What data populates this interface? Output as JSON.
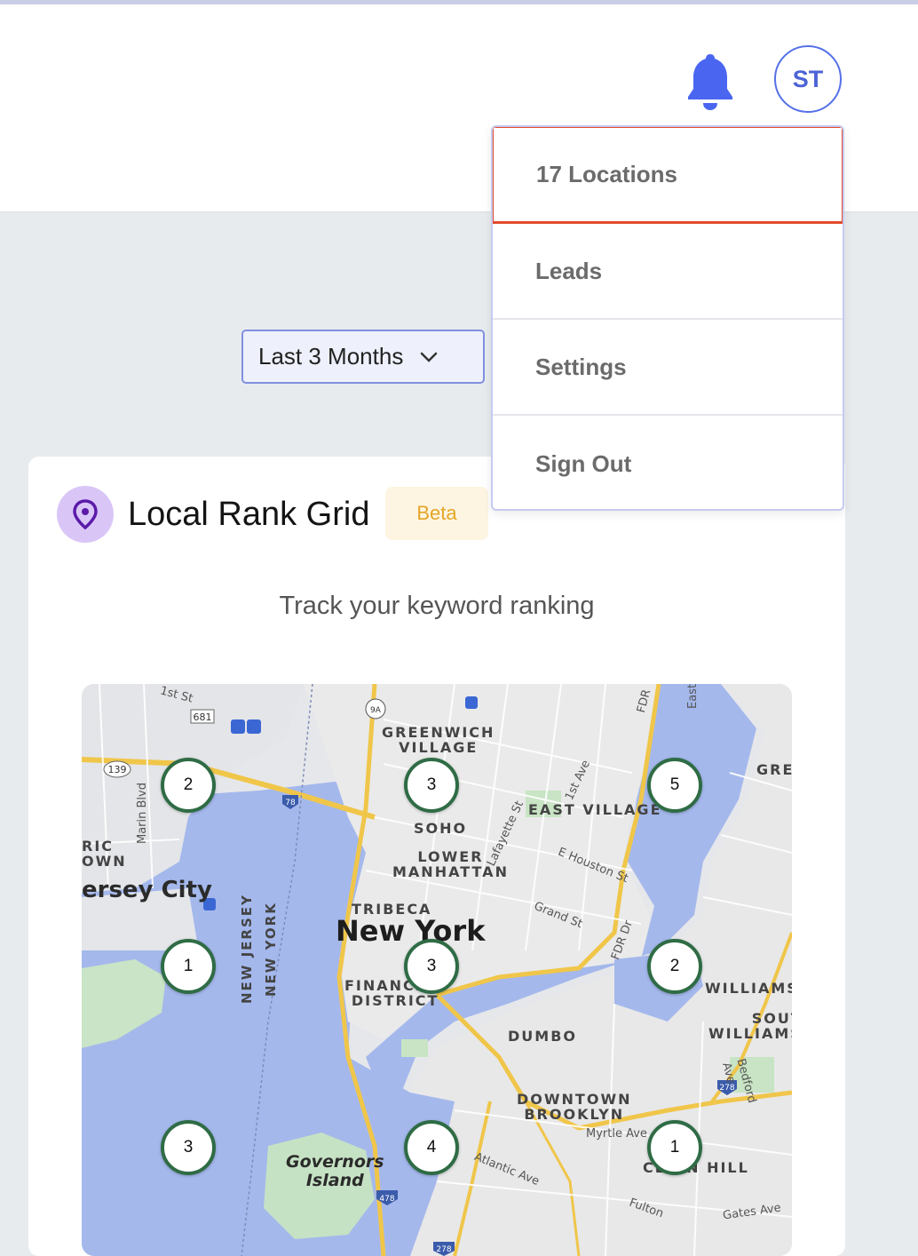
{
  "header": {
    "avatar_initials": "ST",
    "bell_icon": "bell-icon",
    "accent_color": "#4a66f0"
  },
  "menu": {
    "items": [
      "17 Locations",
      "Leads",
      "Settings",
      "Sign Out"
    ],
    "highlight_color": "#e24a2c"
  },
  "filter": {
    "date_range": "Last 3 Months",
    "chevron_icon": "chevron-down-icon"
  },
  "card": {
    "icon": "location-pin-icon",
    "title": "Local Rank Grid",
    "badge": "Beta",
    "subtitle": "Track your keyword ranking"
  },
  "map": {
    "ranks": [
      "2",
      "3",
      "5",
      "1",
      "3",
      "2",
      "3",
      "4",
      "1"
    ],
    "labels": {
      "greenwich": "GREENWICH\nVILLAGE",
      "east_village": "EAST VILLAGE",
      "soho": "SOHO",
      "lower_manhattan": "LOWER\nMANHATTAN",
      "tribeca": "TRIBECA",
      "new_york": "New York",
      "financial": "FINANCIAL\nDISTRICT",
      "dumbo": "DUMBO",
      "downtown_brooklyn": "DOWNTOWN\nBROOKLYN",
      "williamsburg": "WILLIAMSI",
      "south_williamsburg": "SOUT\nWILLIAMS",
      "jersey_city": "ersey City",
      "governors": "Governors\nIsland",
      "nj": "NEW JERSEY",
      "ny": "NEW YORK",
      "gree": "GREI",
      "historic": "RIC\nOWN",
      "clinton": "CL    ON HILL",
      "myrtle": "Myrtle Ave",
      "atlantic": "Atlantic Ave",
      "houston": "E Houston St",
      "grand": "Grand St",
      "lafayette": "Lafayette St",
      "first_ave": "1st Ave",
      "fdr": "FDR Dr",
      "marin": "Marin Blvd",
      "bedford": "Bedford Ave",
      "first_st": "1st St",
      "fulton": "Fulton",
      "gates": "Gates Ave",
      "east": "East",
      "fdr_top": "FDR",
      "shield_681": "681",
      "shield_139": "139",
      "shield_78": "78",
      "shield_9a": "9A",
      "shield_278": "278",
      "shield_478": "478"
    }
  }
}
